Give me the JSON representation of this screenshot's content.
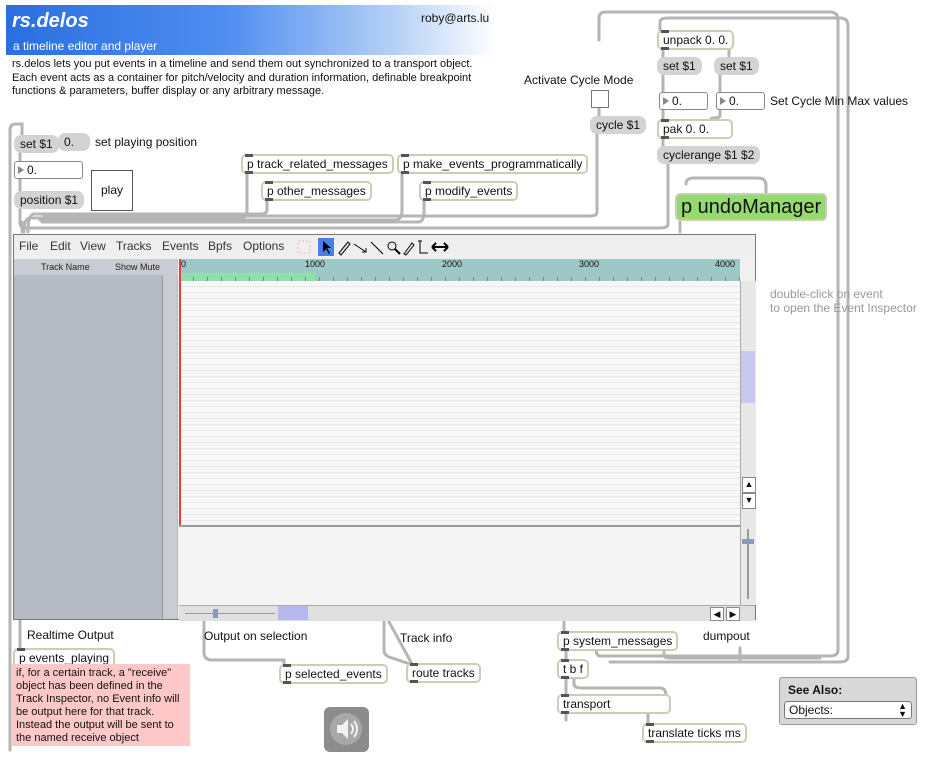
{
  "header": {
    "title": "rs.delos",
    "subtitle": "a timeline editor and player",
    "email": "roby@arts.lu",
    "description": "rs.delos lets you put events in a timeline and send them out synchronized to a transport object.\nEach event acts as a container for pitch/velocity and duration information, definable breakpoint functions & parameters, buffer display or any arbitrary message."
  },
  "objects": {
    "track_related": "p track_related_messages",
    "make_events": "p make_events_programmatically",
    "other_messages": "p other_messages",
    "modify_events": "p modify_events",
    "undo": "p undoManager",
    "unpack": "unpack 0. 0.",
    "pak": "pak 0. 0.",
    "events_playing": "p events_playing",
    "selected_events": "p selected_events",
    "route_tracks": "route tracks",
    "system_messages": "p system_messages",
    "tbf": "t b f",
    "transport": "transport",
    "translate": "translate ticks ms"
  },
  "messages": {
    "set1_left": "set $1",
    "zero_msg": "0.",
    "position": "position $1",
    "cycle": "cycle $1",
    "set1_a": "set $1",
    "set1_b": "set $1",
    "cyclerange": "cyclerange $1 $2"
  },
  "numbers": {
    "pos": "0.",
    "min": "0.",
    "max": "0."
  },
  "comments": {
    "set_playing": "set playing position",
    "activate_cycle": "Activate Cycle Mode",
    "set_cycle": "Set Cycle Min Max values",
    "double_click": "double-click on event\nto open the Event Inspector",
    "realtime": "Realtime Output",
    "output_selection": "Output on selection",
    "track_info": "Track info",
    "dumpout": "dumpout",
    "note": "if, for a certain track, a \"receive\" object has been defined in the Track Inspector, no Event info will be output here for that track. Instead the output will be sent to the named receive object"
  },
  "play_button": "play",
  "editor": {
    "menu": [
      "File",
      "Edit",
      "View",
      "Tracks",
      "Events",
      "Bpfs",
      "Options"
    ],
    "track_name_header": "Track Name",
    "show_mute_header": "Show  Mute",
    "ruler_ticks": [
      "0",
      "1000",
      "2000",
      "3000",
      "4000"
    ],
    "tools": [
      "select-icon",
      "pencil-icon",
      "move-icon",
      "line-icon",
      "zoom-icon",
      "brush-icon",
      "time-cursor-icon",
      "resize-icon"
    ]
  },
  "see_also": {
    "label": "See Also:",
    "selected": "Objects:"
  },
  "colors": {
    "object_border": "#c7cfb4",
    "undo_fill": "#94da70",
    "note_fill": "#ffc8c8",
    "ruler": "#9ec7c7",
    "header_blue": "#2a6fe0"
  }
}
